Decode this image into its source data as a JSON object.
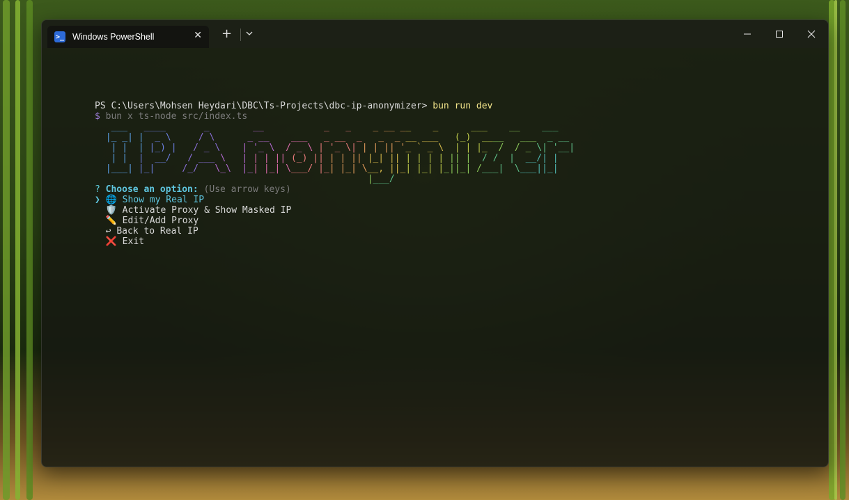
{
  "window": {
    "tab_title": "Windows PowerShell",
    "new_tab_label": "+",
    "dropdown_label": "⌄",
    "minimize": "—",
    "maximize": "☐",
    "close": "✕"
  },
  "terminal": {
    "prompt": "PS C:\\Users\\Mohsen Heydari\\DBC\\Ts-Projects\\dbc-ip-anonymizer>",
    "command": "bun run dev",
    "subcommand_symbol": "$",
    "subcommand": "bun x ts-node src/index.ts",
    "banner_lines": [
      "  ___   ____       _        __           _   _    _ __ __    _      ___    __    ___ ",
      " |_ _| |  _ \\     / \\      _ __    ___   _ __  _   _  _ __ ___   (_)  ____   ___  _ __",
      "  | |  | |_) |   / _ \\    | '_ \\  / _ \\ | '_ \\| | | || '_ ` _ \\  | | |_  /  / _ \\| '__|",
      "  | |  |  __/   / ___ \\   | | | || (_) || | | || |_| || | | | | || |  / /  |  __/| |",
      " |___| |_|     /_/   \\_\\  |_| |_| \\___/ |_| |_| \\__, ||_| |_| |_||_| /___|  \\___||_|",
      "                                                 |___/"
    ],
    "banner_colors": [
      "#5aa0e6",
      "#6b7fe0",
      "#8a6fd8",
      "#b168cf",
      "#d86aa8",
      "#e87a7a",
      "#e09a5a",
      "#d4b84a",
      "#bcc94a",
      "#8cc95a",
      "#5fc08a",
      "#4fb6b0"
    ],
    "question_mark": "?",
    "question": "Choose an option:",
    "hint": "(Use arrow keys)",
    "pointer": "❯",
    "options": [
      {
        "icon": "🌐",
        "label": "Show my Real IP"
      },
      {
        "icon": "🛡️",
        "label": "Activate Proxy & Show Masked IP"
      },
      {
        "icon": "✏️",
        "label": "Edit/Add Proxy"
      },
      {
        "icon": "↩",
        "label": "Back to Real IP"
      },
      {
        "icon": "❌",
        "label": "Exit"
      }
    ]
  }
}
